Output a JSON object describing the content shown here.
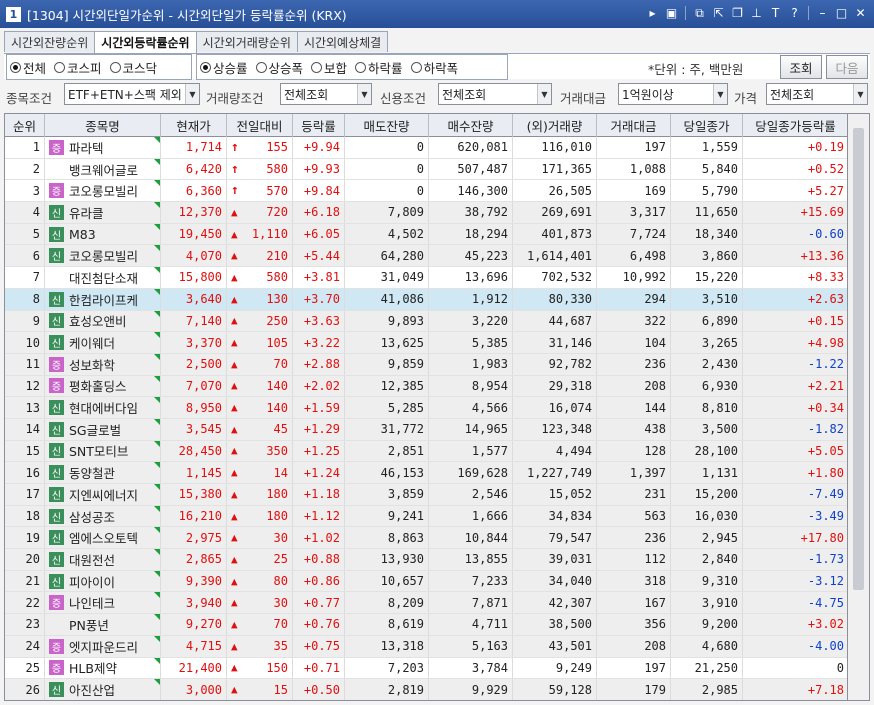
{
  "window": {
    "number": "1",
    "title": "[1304] 시간외단일가순위 - 시간외단일가 등락률순위 (KRX)"
  },
  "title_tools": [
    "arrow-right-icon",
    "menu-m-icon",
    "link-icon",
    "expand-icon",
    "window-icon",
    "pin-icon",
    "help-icon",
    "question-icon",
    "minimize-icon",
    "maximize-icon",
    "close-icon"
  ],
  "tabs": [
    "시간외잔량순위",
    "시간외등락률순위",
    "시간외거래량순위",
    "시간외예상체결"
  ],
  "active_tab": 1,
  "market_radios": [
    {
      "label": "전체",
      "checked": true
    },
    {
      "label": "코스피",
      "checked": false
    },
    {
      "label": "코스닥",
      "checked": false
    }
  ],
  "sort_radios": [
    {
      "label": "상승률",
      "checked": true
    },
    {
      "label": "상승폭",
      "checked": false
    },
    {
      "label": "보합",
      "checked": false
    },
    {
      "label": "하락률",
      "checked": false
    },
    {
      "label": "하락폭",
      "checked": false
    }
  ],
  "unit_text": "*단위 : 주, 백만원",
  "buttons": {
    "query": "조회",
    "next": "다음"
  },
  "filters": {
    "stock_label": "종목조건",
    "stock_value": "ETF+ETN+스팩 제외",
    "volume_label": "거래량조건",
    "volume_value": "전체조회",
    "credit_label": "신용조건",
    "credit_value": "전체조회",
    "amount_label": "거래대금",
    "amount_value": "1억원이상",
    "price_label": "가격",
    "price_value": "전체조회"
  },
  "columns": [
    "순위",
    "종목명",
    "현재가",
    "전일대비",
    "등락률",
    "매도잔량",
    "매수잔량",
    "(외)거래량",
    "거래대금",
    "당일종가",
    "당일종가등락률"
  ],
  "colors": {
    "up": "#e01010",
    "down": "#1040c8",
    "badge_j": "#c964c9",
    "badge_s": "#3b8f5a",
    "selected_row": "#cfe8f4"
  },
  "rows": [
    {
      "rank": "1",
      "badge": "증",
      "name": "파라텍",
      "price": "1,714",
      "symbol": "↑",
      "change": "155",
      "rate": "+9.94",
      "ask": "0",
      "bid": "620,081",
      "volume": "116,010",
      "amount": "197",
      "close": "1,559",
      "close_rate": "+0.19",
      "close_dir": "up"
    },
    {
      "rank": "2",
      "badge": "",
      "name": "뱅크웨어글로",
      "price": "6,420",
      "symbol": "↑",
      "change": "580",
      "rate": "+9.93",
      "ask": "0",
      "bid": "507,487",
      "volume": "171,365",
      "amount": "1,088",
      "close": "5,840",
      "close_rate": "+0.52",
      "close_dir": "up"
    },
    {
      "rank": "3",
      "badge": "증",
      "name": "코오롱모빌리",
      "price": "6,360",
      "symbol": "↑",
      "change": "570",
      "rate": "+9.84",
      "ask": "0",
      "bid": "146,300",
      "volume": "26,505",
      "amount": "169",
      "close": "5,790",
      "close_rate": "+5.27",
      "close_dir": "up"
    },
    {
      "rank": "4",
      "badge": "신",
      "name": "유라클",
      "price": "12,370",
      "symbol": "▲",
      "change": "720",
      "rate": "+6.18",
      "ask": "7,809",
      "bid": "38,792",
      "volume": "269,691",
      "amount": "3,317",
      "close": "11,650",
      "close_rate": "+15.69",
      "close_dir": "up"
    },
    {
      "rank": "5",
      "badge": "신",
      "name": "M83",
      "price": "19,450",
      "symbol": "▲",
      "change": "1,110",
      "rate": "+6.05",
      "ask": "4,502",
      "bid": "18,294",
      "volume": "401,873",
      "amount": "7,724",
      "close": "18,340",
      "close_rate": "-0.60",
      "close_dir": "dn"
    },
    {
      "rank": "6",
      "badge": "신",
      "name": "코오롱모빌리",
      "price": "4,070",
      "symbol": "▲",
      "change": "210",
      "rate": "+5.44",
      "ask": "64,280",
      "bid": "45,223",
      "volume": "1,614,401",
      "amount": "6,498",
      "close": "3,860",
      "close_rate": "+13.36",
      "close_dir": "up"
    },
    {
      "rank": "7",
      "badge": "",
      "name": "대진첨단소재",
      "price": "15,800",
      "symbol": "▲",
      "change": "580",
      "rate": "+3.81",
      "ask": "31,049",
      "bid": "13,696",
      "volume": "702,532",
      "amount": "10,992",
      "close": "15,220",
      "close_rate": "+8.33",
      "close_dir": "up"
    },
    {
      "rank": "8",
      "badge": "신",
      "name": "한컴라이프케",
      "price": "3,640",
      "symbol": "▲",
      "change": "130",
      "rate": "+3.70",
      "ask": "41,086",
      "bid": "1,912",
      "volume": "80,330",
      "amount": "294",
      "close": "3,510",
      "close_rate": "+2.63",
      "close_dir": "up"
    },
    {
      "rank": "9",
      "badge": "신",
      "name": "효성오앤비",
      "price": "7,140",
      "symbol": "▲",
      "change": "250",
      "rate": "+3.63",
      "ask": "9,893",
      "bid": "3,220",
      "volume": "44,687",
      "amount": "322",
      "close": "6,890",
      "close_rate": "+0.15",
      "close_dir": "up"
    },
    {
      "rank": "10",
      "badge": "신",
      "name": "케이웨더",
      "price": "3,370",
      "symbol": "▲",
      "change": "105",
      "rate": "+3.22",
      "ask": "13,625",
      "bid": "5,385",
      "volume": "31,146",
      "amount": "104",
      "close": "3,265",
      "close_rate": "+4.98",
      "close_dir": "up"
    },
    {
      "rank": "11",
      "badge": "증",
      "name": "성보화학",
      "price": "2,500",
      "symbol": "▲",
      "change": "70",
      "rate": "+2.88",
      "ask": "9,859",
      "bid": "1,983",
      "volume": "92,782",
      "amount": "236",
      "close": "2,430",
      "close_rate": "-1.22",
      "close_dir": "dn"
    },
    {
      "rank": "12",
      "badge": "증",
      "name": "평화홀딩스",
      "price": "7,070",
      "symbol": "▲",
      "change": "140",
      "rate": "+2.02",
      "ask": "12,385",
      "bid": "8,954",
      "volume": "29,318",
      "amount": "208",
      "close": "6,930",
      "close_rate": "+2.21",
      "close_dir": "up"
    },
    {
      "rank": "13",
      "badge": "신",
      "name": "현대에버다임",
      "price": "8,950",
      "symbol": "▲",
      "change": "140",
      "rate": "+1.59",
      "ask": "5,285",
      "bid": "4,566",
      "volume": "16,074",
      "amount": "144",
      "close": "8,810",
      "close_rate": "+0.34",
      "close_dir": "up"
    },
    {
      "rank": "14",
      "badge": "신",
      "name": "SG글로벌",
      "price": "3,545",
      "symbol": "▲",
      "change": "45",
      "rate": "+1.29",
      "ask": "31,772",
      "bid": "14,965",
      "volume": "123,348",
      "amount": "438",
      "close": "3,500",
      "close_rate": "-1.82",
      "close_dir": "dn"
    },
    {
      "rank": "15",
      "badge": "신",
      "name": "SNT모티브",
      "price": "28,450",
      "symbol": "▲",
      "change": "350",
      "rate": "+1.25",
      "ask": "2,851",
      "bid": "1,577",
      "volume": "4,494",
      "amount": "128",
      "close": "28,100",
      "close_rate": "+5.05",
      "close_dir": "up"
    },
    {
      "rank": "16",
      "badge": "신",
      "name": "동양철관",
      "price": "1,145",
      "symbol": "▲",
      "change": "14",
      "rate": "+1.24",
      "ask": "46,153",
      "bid": "169,628",
      "volume": "1,227,749",
      "amount": "1,397",
      "close": "1,131",
      "close_rate": "+1.80",
      "close_dir": "up"
    },
    {
      "rank": "17",
      "badge": "신",
      "name": "지엔씨에너지",
      "price": "15,380",
      "symbol": "▲",
      "change": "180",
      "rate": "+1.18",
      "ask": "3,859",
      "bid": "2,546",
      "volume": "15,052",
      "amount": "231",
      "close": "15,200",
      "close_rate": "-7.49",
      "close_dir": "dn"
    },
    {
      "rank": "18",
      "badge": "신",
      "name": "삼성공조",
      "price": "16,210",
      "symbol": "▲",
      "change": "180",
      "rate": "+1.12",
      "ask": "9,241",
      "bid": "1,666",
      "volume": "34,834",
      "amount": "563",
      "close": "16,030",
      "close_rate": "-3.49",
      "close_dir": "dn"
    },
    {
      "rank": "19",
      "badge": "신",
      "name": "엠에스오토텍",
      "price": "2,975",
      "symbol": "▲",
      "change": "30",
      "rate": "+1.02",
      "ask": "8,863",
      "bid": "10,844",
      "volume": "79,547",
      "amount": "236",
      "close": "2,945",
      "close_rate": "+17.80",
      "close_dir": "up"
    },
    {
      "rank": "20",
      "badge": "신",
      "name": "대원전선",
      "price": "2,865",
      "symbol": "▲",
      "change": "25",
      "rate": "+0.88",
      "ask": "13,930",
      "bid": "13,855",
      "volume": "39,031",
      "amount": "112",
      "close": "2,840",
      "close_rate": "-1.73",
      "close_dir": "dn"
    },
    {
      "rank": "21",
      "badge": "신",
      "name": "피아이이",
      "price": "9,390",
      "symbol": "▲",
      "change": "80",
      "rate": "+0.86",
      "ask": "10,657",
      "bid": "7,233",
      "volume": "34,040",
      "amount": "318",
      "close": "9,310",
      "close_rate": "-3.12",
      "close_dir": "dn"
    },
    {
      "rank": "22",
      "badge": "증",
      "name": "나인테크",
      "price": "3,940",
      "symbol": "▲",
      "change": "30",
      "rate": "+0.77",
      "ask": "8,209",
      "bid": "7,871",
      "volume": "42,307",
      "amount": "167",
      "close": "3,910",
      "close_rate": "-4.75",
      "close_dir": "dn"
    },
    {
      "rank": "23",
      "badge": "",
      "name": "PN풍년",
      "price": "9,270",
      "symbol": "▲",
      "change": "70",
      "rate": "+0.76",
      "ask": "8,619",
      "bid": "4,711",
      "volume": "38,500",
      "amount": "356",
      "close": "9,200",
      "close_rate": "+3.02",
      "close_dir": "up"
    },
    {
      "rank": "24",
      "badge": "증",
      "name": "엣지파운드리",
      "price": "4,715",
      "symbol": "▲",
      "change": "35",
      "rate": "+0.75",
      "ask": "13,318",
      "bid": "5,163",
      "volume": "43,501",
      "amount": "208",
      "close": "4,680",
      "close_rate": "-4.00",
      "close_dir": "dn"
    },
    {
      "rank": "25",
      "badge": "증",
      "name": "HLB제약",
      "price": "21,400",
      "symbol": "▲",
      "change": "150",
      "rate": "+0.71",
      "ask": "7,203",
      "bid": "3,784",
      "volume": "9,249",
      "amount": "197",
      "close": "21,250",
      "close_rate": "0",
      "close_dir": "flat"
    },
    {
      "rank": "26",
      "badge": "신",
      "name": "아진산업",
      "price": "3,000",
      "symbol": "▲",
      "change": "15",
      "rate": "+0.50",
      "ask": "2,819",
      "bid": "9,929",
      "volume": "59,128",
      "amount": "179",
      "close": "2,985",
      "close_rate": "+7.18",
      "close_dir": "up"
    }
  ]
}
